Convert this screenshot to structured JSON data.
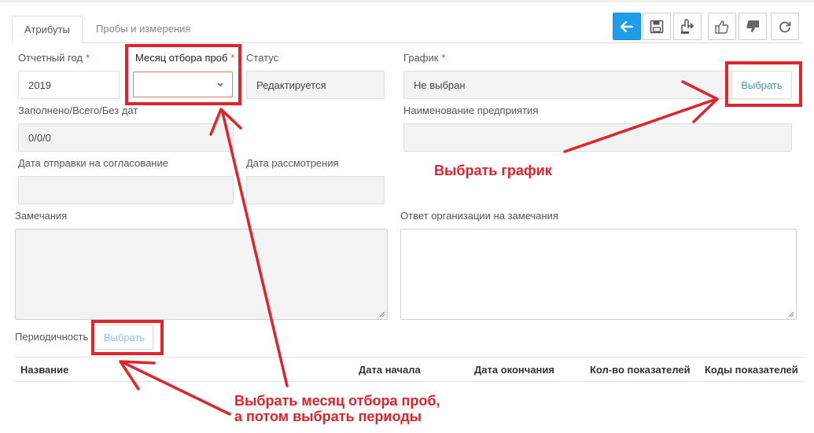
{
  "tabs": [
    {
      "label": "Атрибуты",
      "active": true
    },
    {
      "label": "Пробы и измерения",
      "active": false
    }
  ],
  "toolbar": {
    "icons": [
      "arrow-left-icon",
      "save-icon",
      "send-icon",
      "thumbs-up-icon",
      "thumbs-down-icon",
      "refresh-icon"
    ],
    "accent": "#1e9ee8"
  },
  "form": {
    "year_label": "Отчетный год",
    "year_value": "2019",
    "month_label": "Месяц отбора проб",
    "month_value": "",
    "status_label": "Статус",
    "status_value": "Редактируется",
    "schedule_label": "График",
    "schedule_value": "Не выбран",
    "schedule_button": "Выбрать",
    "filled_label": "Заполнено/Всего/Без дат",
    "filled_value": "0/0/0",
    "enterprise_label": "Наименование предприятия",
    "enterprise_value": "",
    "send_date_label": "Дата отправки на согласование",
    "send_date_value": "",
    "review_date_label": "Дата рассмотрения",
    "review_date_value": "",
    "remarks_label": "Замечания",
    "response_label": "Ответ организации на замечания",
    "periodicity_label": "Периодичность",
    "periodicity_button": "Выбрать",
    "required_mark": "*"
  },
  "table": {
    "columns": [
      "Название",
      "Дата начала",
      "Дата окончания",
      "Кол-во показателей",
      "Коды показателей"
    ]
  },
  "annotations": {
    "schedule_note": "Выбрать график",
    "month_note_line1": "Выбрать месяц отбора проб,",
    "month_note_line2": "а потом выбрать периоды",
    "color": "#e0242d"
  }
}
